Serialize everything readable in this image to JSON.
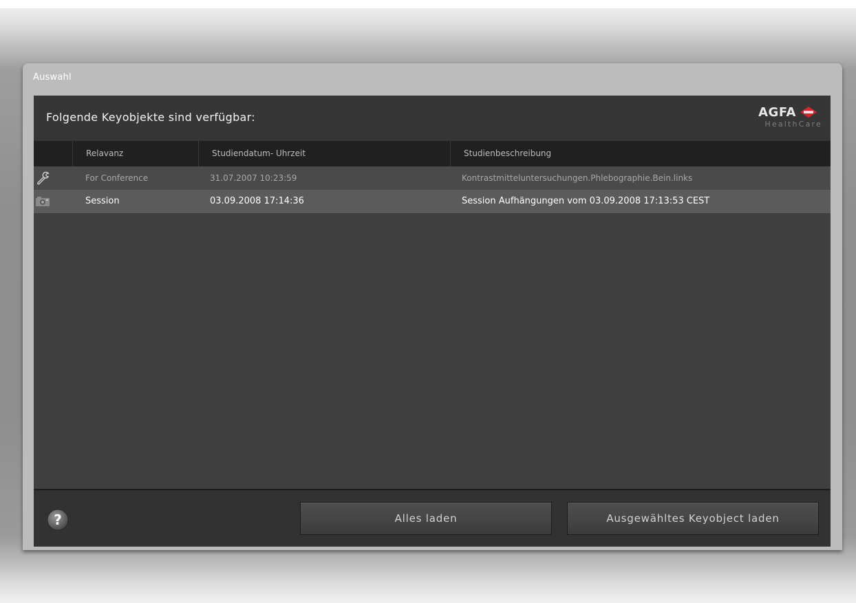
{
  "dialog": {
    "title": "Auswahl",
    "heading": "Folgende Keyobjekte sind verfügbar:",
    "logo": {
      "brand": "AGFA",
      "subtitle": "HealthCare",
      "diamond_text": "Agfa",
      "brand_color": "#d6242b"
    }
  },
  "table": {
    "columns": [
      "Relavanz",
      "Studiendatum- Uhrzeit",
      "Studienbeschreibung"
    ],
    "rows": [
      {
        "icon": "wrench-icon",
        "relevance": "For Conference",
        "datetime": "31.07.2007 10:23:59",
        "description": "Kontrastmitteluntersuchungen.Phlebographie.Bein.links"
      },
      {
        "icon": "camera-icon",
        "relevance": "Session",
        "datetime": "03.09.2008 17:14:36",
        "description": "Session Aufhängungen vom 03.09.2008 17:13:53 CEST"
      }
    ]
  },
  "footer": {
    "help_icon": "help-icon",
    "load_all_label": "Alles laden",
    "load_selected_label": "Ausgewähltes Keyobject laden"
  }
}
